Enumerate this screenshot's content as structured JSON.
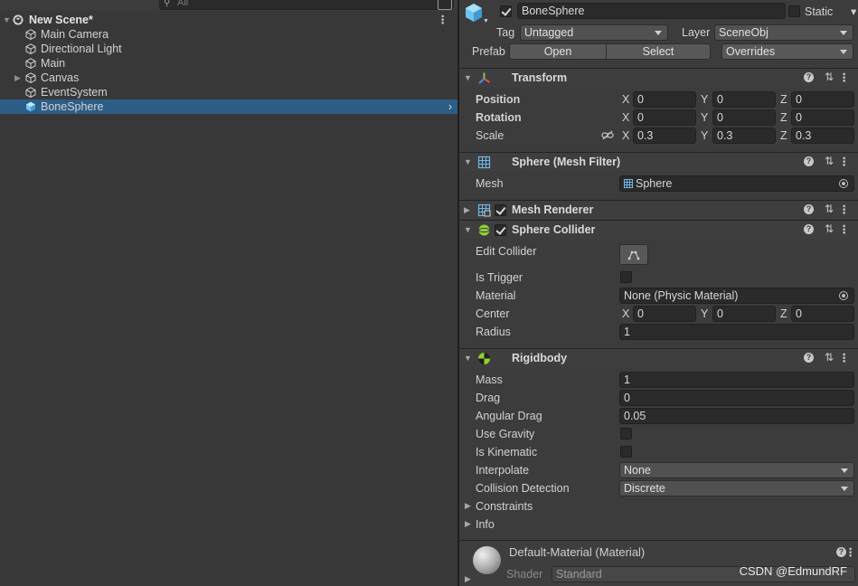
{
  "hierarchy": {
    "search_placeholder": "All",
    "scene_name": "New Scene*",
    "items": [
      {
        "label": "Main Camera",
        "expandable": false
      },
      {
        "label": "Directional Light",
        "expandable": false
      },
      {
        "label": "Main",
        "expandable": false
      },
      {
        "label": "Canvas",
        "expandable": true
      },
      {
        "label": "EventSystem",
        "expandable": false
      },
      {
        "label": "BoneSphere",
        "expandable": false,
        "selected": true
      }
    ]
  },
  "inspector": {
    "object_name": "BoneSphere",
    "active": true,
    "static_label": "Static",
    "static_checked": false,
    "tag_label": "Tag",
    "tag_value": "Untagged",
    "layer_label": "Layer",
    "layer_value": "SceneObj",
    "prefab_label": "Prefab",
    "prefab_open": "Open",
    "prefab_select": "Select",
    "prefab_overrides": "Overrides",
    "transform": {
      "title": "Transform",
      "position_label": "Position",
      "rotation_label": "Rotation",
      "scale_label": "Scale",
      "position": {
        "x": "0",
        "y": "0",
        "z": "0"
      },
      "rotation": {
        "x": "0",
        "y": "0",
        "z": "0"
      },
      "scale": {
        "x": "0.3",
        "y": "0.3",
        "z": "0.3"
      },
      "axis_x": "X",
      "axis_y": "Y",
      "axis_z": "Z"
    },
    "mesh_filter": {
      "title": "Sphere (Mesh Filter)",
      "mesh_label": "Mesh",
      "mesh_value": "Sphere"
    },
    "mesh_renderer": {
      "title": "Mesh Renderer",
      "enabled": true
    },
    "sphere_collider": {
      "title": "Sphere Collider",
      "enabled": true,
      "edit_collider_label": "Edit Collider",
      "is_trigger_label": "Is Trigger",
      "is_trigger": false,
      "material_label": "Material",
      "material_value": "None (Physic Material)",
      "center_label": "Center",
      "center": {
        "x": "0",
        "y": "0",
        "z": "0"
      },
      "radius_label": "Radius",
      "radius": "1"
    },
    "rigidbody": {
      "title": "Rigidbody",
      "mass_label": "Mass",
      "mass": "1",
      "drag_label": "Drag",
      "drag": "0",
      "angular_drag_label": "Angular Drag",
      "angular_drag": "0.05",
      "use_gravity_label": "Use Gravity",
      "use_gravity": false,
      "is_kinematic_label": "Is Kinematic",
      "is_kinematic": false,
      "interpolate_label": "Interpolate",
      "interpolate": "None",
      "collision_detection_label": "Collision Detection",
      "collision_detection": "Discrete",
      "constraints_label": "Constraints",
      "info_label": "Info"
    },
    "material": {
      "title": "Default-Material (Material)",
      "shader_label": "Shader",
      "shader_value": "Standard"
    },
    "watermark": "CSDN @EdmundRF"
  },
  "colors": {
    "selection": "#2c5d87",
    "panel": "#383838",
    "inspector": "#3c3c3c",
    "field": "#2a2a2a",
    "transform_icon_x": "#e05050",
    "transform_icon_y": "#7fcf3f",
    "transform_icon_z": "#4f8cf0",
    "collider_icon": "#8ed233",
    "cube_icon": "#6fc3f0"
  }
}
